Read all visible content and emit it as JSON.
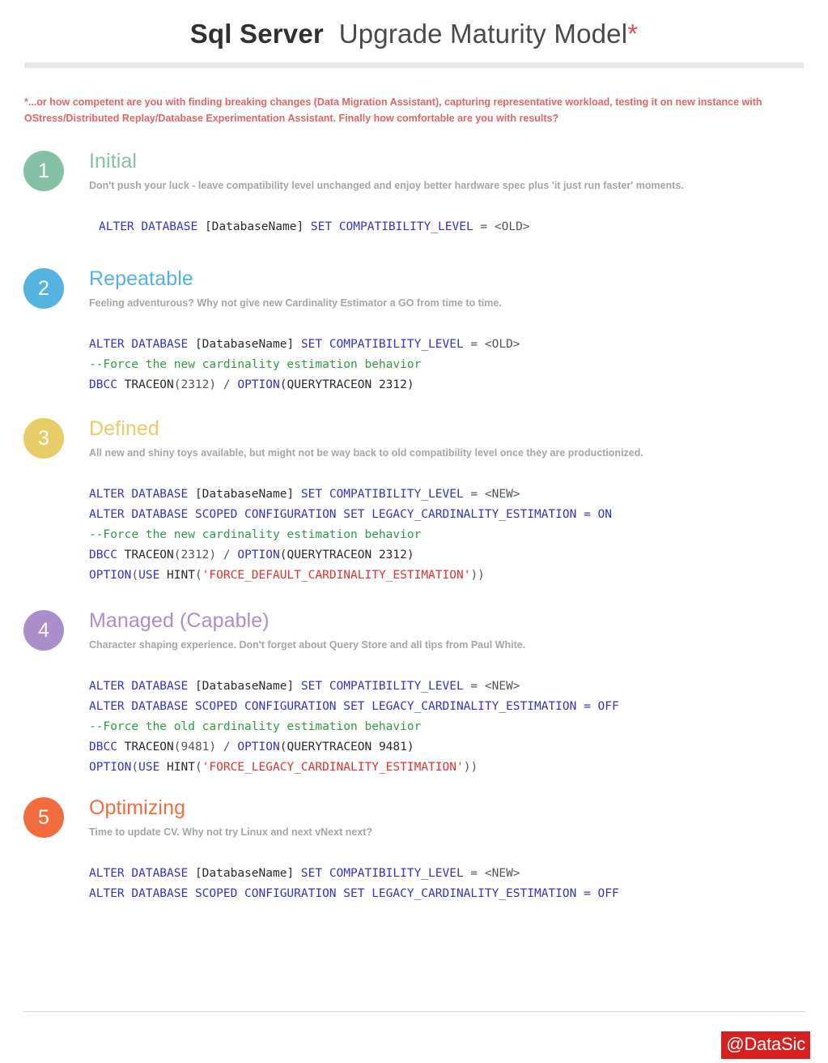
{
  "header": {
    "title_brand": "Sql Server",
    "title_rest": "Upgrade Maturity Model",
    "title_star": "*"
  },
  "subtitle": {
    "part1": "*...or how competent are you with finding breaking changes (",
    "bold1": "Data Migration Assistant",
    "part2": "), capturing representative workload, testing it on new instance with ",
    "bold2": "OStress/Distributed Replay/Database Experimentation Assistant.",
    "part3": " Finally how comfortable are you with results?"
  },
  "sections": [
    {
      "number": "1",
      "title": "Initial",
      "color": "#85c2a5",
      "description": "Don't push your luck - leave compatibility level unchanged and enjoy better hardware spec plus 'it just run faster'  moments.",
      "code_lines": [
        [
          {
            "t": "ALTER DATABASE ",
            "c": "kw"
          },
          {
            "t": "[DatabaseName] ",
            "c": "id"
          },
          {
            "t": "SET COMPATIBILITY_LEVEL ",
            "c": "kw"
          },
          {
            "t": "= <OLD>",
            "c": "op"
          }
        ]
      ]
    },
    {
      "number": "2",
      "title": "Repeatable",
      "color": "#54b3e0",
      "description": "Feeling adventurous? Why not give new Cardinality Estimator a GO from time to time.",
      "code_lines": [
        [
          {
            "t": "ALTER DATABASE ",
            "c": "kw"
          },
          {
            "t": "[DatabaseName] ",
            "c": "id"
          },
          {
            "t": "SET COMPATIBILITY_LEVEL ",
            "c": "kw"
          },
          {
            "t": "= <OLD>",
            "c": "op"
          }
        ],
        [
          {
            "t": "--Force the new cardinality estimation behavior",
            "c": "cm"
          }
        ],
        [
          {
            "t": "DBCC ",
            "c": "kw"
          },
          {
            "t": "TRACEON",
            "c": "id"
          },
          {
            "t": "(2312) / ",
            "c": "op"
          },
          {
            "t": "OPTION",
            "c": "kw"
          },
          {
            "t": "(QUERYTRACEON 2312)",
            "c": "id"
          }
        ]
      ]
    },
    {
      "number": "3",
      "title": "Defined",
      "color": "#e8cc68",
      "description": "All new and shiny toys available, but might not be way back to old compatibility level once they are productionized.",
      "code_lines": [
        [
          {
            "t": "ALTER DATABASE ",
            "c": "kw"
          },
          {
            "t": "[DatabaseName] ",
            "c": "id"
          },
          {
            "t": "SET COMPATIBILITY_LEVEL ",
            "c": "kw"
          },
          {
            "t": "= <NEW>",
            "c": "op"
          }
        ],
        [
          {
            "t": "ALTER DATABASE SCOPED CONFIGURATION SET LEGACY_CARDINALITY_ESTIMATION = ON",
            "c": "kw"
          }
        ],
        [
          {
            "t": "--Force the new cardinality estimation behavior",
            "c": "cm"
          }
        ],
        [
          {
            "t": "DBCC ",
            "c": "kw"
          },
          {
            "t": "TRACEON",
            "c": "id"
          },
          {
            "t": "(2312) / ",
            "c": "op"
          },
          {
            "t": "OPTION",
            "c": "kw"
          },
          {
            "t": "(QUERYTRACEON 2312)",
            "c": "id"
          }
        ],
        [
          {
            "t": "OPTION",
            "c": "kw"
          },
          {
            "t": "(",
            "c": "op"
          },
          {
            "t": "USE ",
            "c": "kw"
          },
          {
            "t": "HINT",
            "c": "id"
          },
          {
            "t": "(",
            "c": "op"
          },
          {
            "t": "'FORCE_DEFAULT_CARDINALITY_ESTIMATION'",
            "c": "str"
          },
          {
            "t": "))",
            "c": "op"
          }
        ]
      ]
    },
    {
      "number": "4",
      "title": "Managed (Capable)",
      "color": "#ab8fcb",
      "description": "Character shaping experience. Don't forget about Query Store and all tips from Paul White.",
      "code_lines": [
        [
          {
            "t": "ALTER DATABASE ",
            "c": "kw"
          },
          {
            "t": "[DatabaseName] ",
            "c": "id"
          },
          {
            "t": "SET COMPATIBILITY_LEVEL ",
            "c": "kw"
          },
          {
            "t": "= <NEW>",
            "c": "op"
          }
        ],
        [
          {
            "t": "ALTER DATABASE SCOPED CONFIGURATION SET LEGACY_CARDINALITY_ESTIMATION = OFF",
            "c": "kw"
          }
        ],
        [
          {
            "t": "--Force the old cardinality estimation behavior",
            "c": "cm"
          }
        ],
        [
          {
            "t": "DBCC ",
            "c": "kw"
          },
          {
            "t": "TRACEON",
            "c": "id"
          },
          {
            "t": "(9481) / ",
            "c": "op"
          },
          {
            "t": "OPTION",
            "c": "kw"
          },
          {
            "t": "(QUERYTRACEON 9481)",
            "c": "id"
          }
        ],
        [
          {
            "t": "OPTION",
            "c": "kw"
          },
          {
            "t": "(",
            "c": "op"
          },
          {
            "t": "USE ",
            "c": "kw"
          },
          {
            "t": "HINT",
            "c": "id"
          },
          {
            "t": "(",
            "c": "op"
          },
          {
            "t": "'FORCE_LEGACY_CARDINALITY_ESTIMATION'",
            "c": "str"
          },
          {
            "t": "))",
            "c": "op"
          }
        ]
      ]
    },
    {
      "number": "5",
      "title": "Optimizing",
      "color": "#f26c3e",
      "description": "Time to update CV. Why not try Linux and next vNext next?",
      "code_lines": [
        [
          {
            "t": "ALTER DATABASE ",
            "c": "kw"
          },
          {
            "t": "[DatabaseName] ",
            "c": "id"
          },
          {
            "t": "SET COMPATIBILITY_LEVEL ",
            "c": "kw"
          },
          {
            "t": "= <NEW>",
            "c": "op"
          }
        ],
        [
          {
            "t": "ALTER DATABASE SCOPED CONFIGURATION SET LEGACY_CARDINALITY_ESTIMATION = OFF",
            "c": "kw"
          }
        ]
      ]
    }
  ],
  "footer": {
    "handle": "@DataSic",
    "handle_bg": "#d62020"
  }
}
